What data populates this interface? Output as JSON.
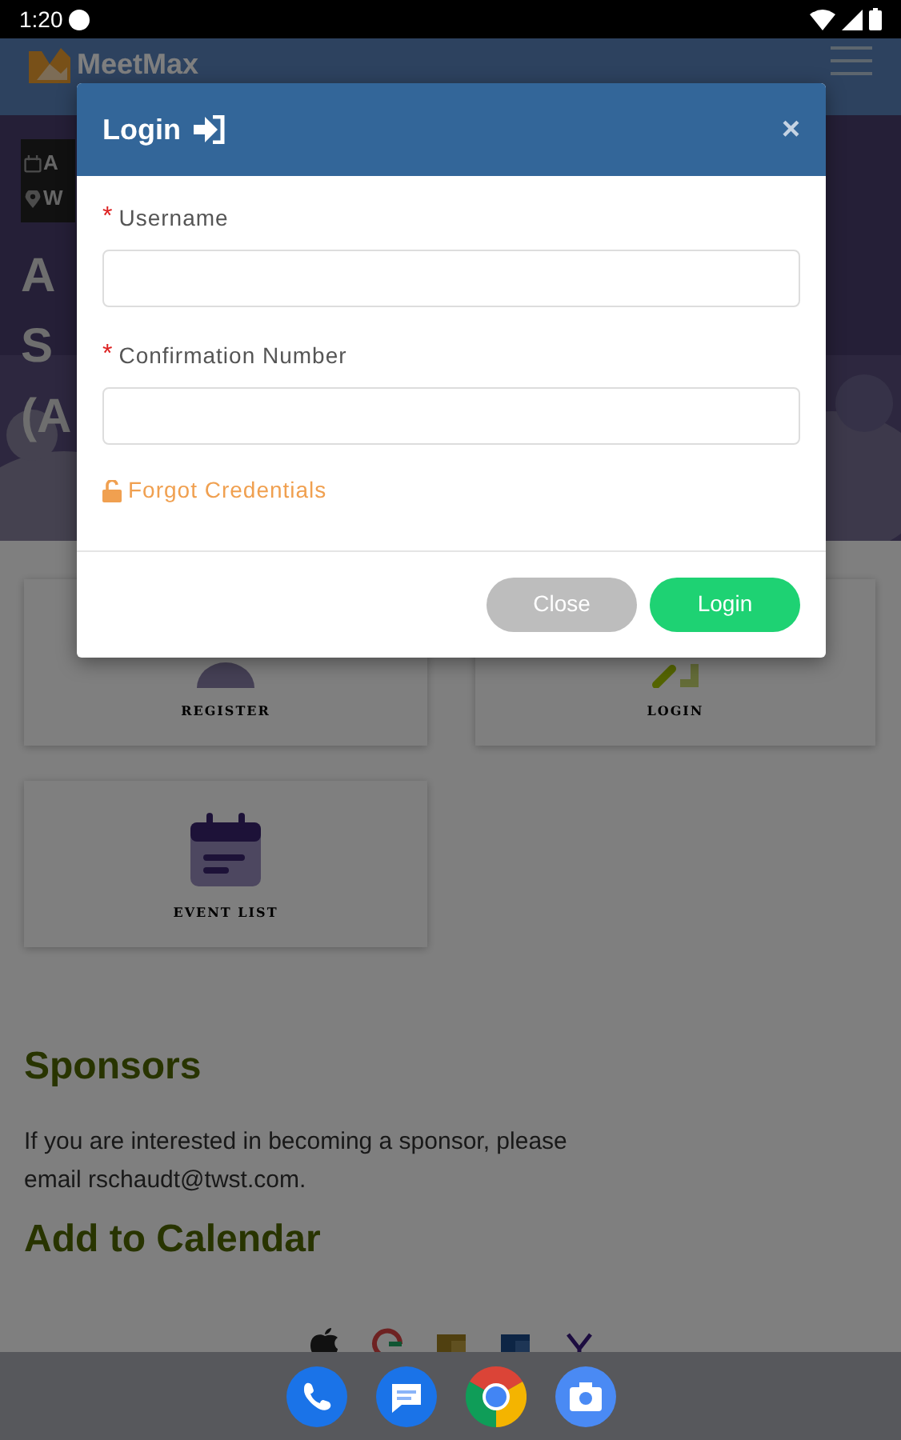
{
  "status_bar": {
    "time": "1:20"
  },
  "navbar": {
    "logo_text": "MeetMax"
  },
  "hero": {
    "meta": [
      {
        "kind": "date",
        "text": "A"
      },
      {
        "kind": "location",
        "text": "W"
      }
    ],
    "title_lines": [
      "A",
      "S",
      "(A"
    ]
  },
  "tiles": [
    {
      "kind": "register",
      "label": "REGISTER"
    },
    {
      "kind": "login",
      "label": "LOGIN"
    },
    {
      "kind": "event-list",
      "label": "EVENT LIST"
    }
  ],
  "sponsors": {
    "heading": "Sponsors",
    "text": "If you are interested in becoming a sponsor, please email rschaudt@twst.com."
  },
  "calendar": {
    "heading": "Add to Calendar",
    "services": [
      {
        "kind": "apple"
      },
      {
        "kind": "google"
      },
      {
        "kind": "office"
      },
      {
        "kind": "outlook"
      },
      {
        "kind": "yahoo"
      }
    ]
  },
  "modal": {
    "title": "Login",
    "close_symbol": "×",
    "fields": [
      {
        "required_mark": "*",
        "label": "Username"
      },
      {
        "required_mark": "*",
        "label": "Confirmation Number"
      }
    ],
    "forgot_link": "Forgot Credentials",
    "buttons": [
      {
        "kind": "secondary",
        "label": "Close"
      },
      {
        "kind": "primary",
        "label": "Login"
      }
    ]
  },
  "dock": [
    {
      "kind": "phone"
    },
    {
      "kind": "messages"
    },
    {
      "kind": "browser"
    },
    {
      "kind": "camera"
    }
  ]
}
